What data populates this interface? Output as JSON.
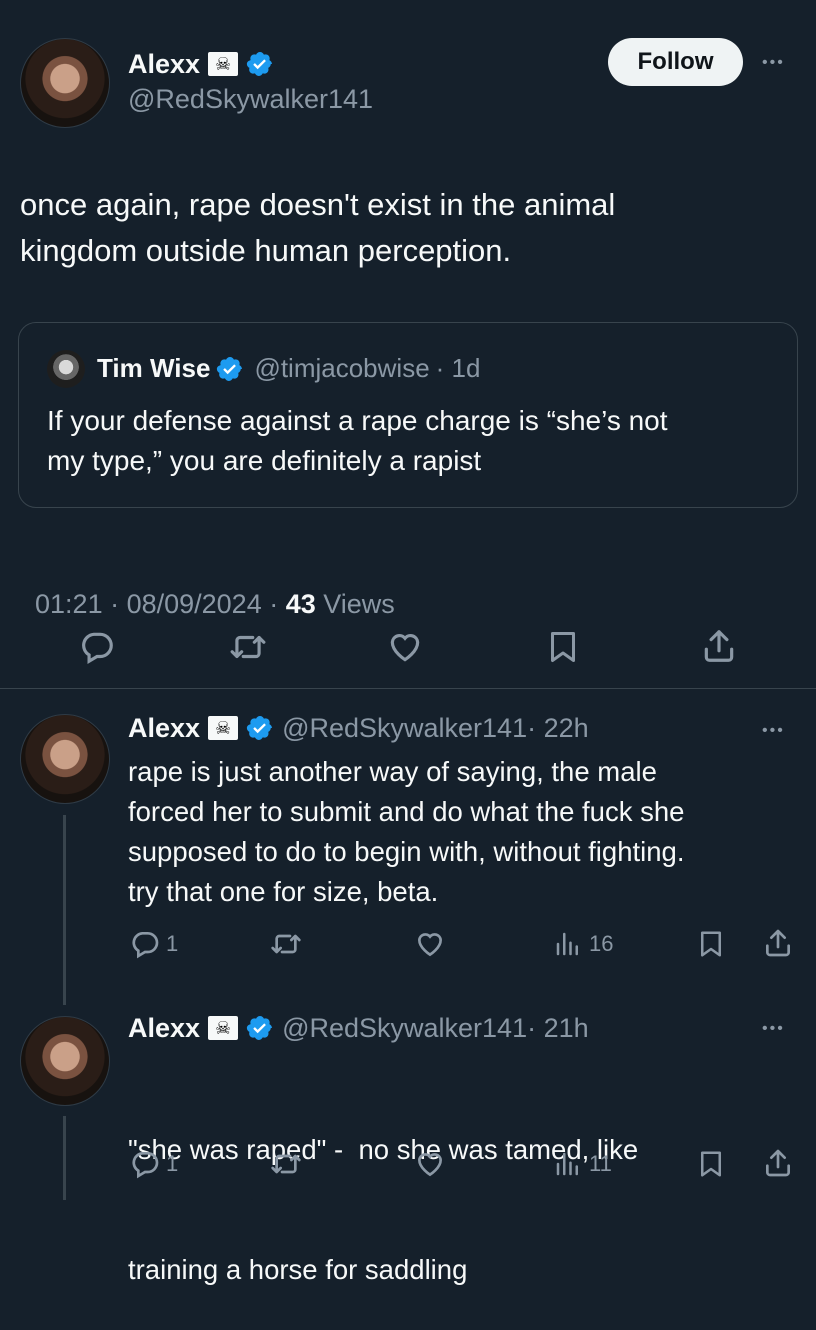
{
  "main_tweet": {
    "author_name": "Alexx",
    "author_flag": "☠",
    "author_handle": "@RedSkywalker141",
    "follow_label": "Follow",
    "more": "•••",
    "text_line1": "once again, rape doesn't exist in the animal",
    "text_line2": "kingdom outside human perception.",
    "time": "01:21 · 08/09/2024 · ",
    "views_count": "43",
    "views_label": " Views"
  },
  "quoted_tweet": {
    "author_name": "Tim Wise",
    "author_handle": "@timjacobwise",
    "age": " · 1d",
    "text_line1": "If your defense against a rape charge is “she’s not",
    "text_line2": "my type,” you are definitely a rapist"
  },
  "replies": [
    {
      "author_name": "Alexx",
      "author_flag": "☠",
      "author_handle": "@RedSkywalker141",
      "age": " · 22h",
      "text_lines": [
        "rape is just another way of saying, the male",
        "forced her to submit and do what the fuck she",
        "supposed to do to begin with, without fighting.",
        "try that one for size, beta."
      ],
      "reply_count": "1",
      "views_count": "16"
    },
    {
      "author_name": "Alexx",
      "author_flag": "☠",
      "author_handle": "@RedSkywalker141",
      "age": " · 21h",
      "text_lines": [
        "\"she was raped\" -  no she was tamed, like",
        "training a horse for saddling"
      ],
      "reply_count": "1",
      "views_count": "11"
    }
  ],
  "colors": {
    "background": "#15202b",
    "text": "#f7f9f9",
    "muted": "#8b98a5",
    "verified": "#1d9bf0",
    "border": "#38444d"
  }
}
